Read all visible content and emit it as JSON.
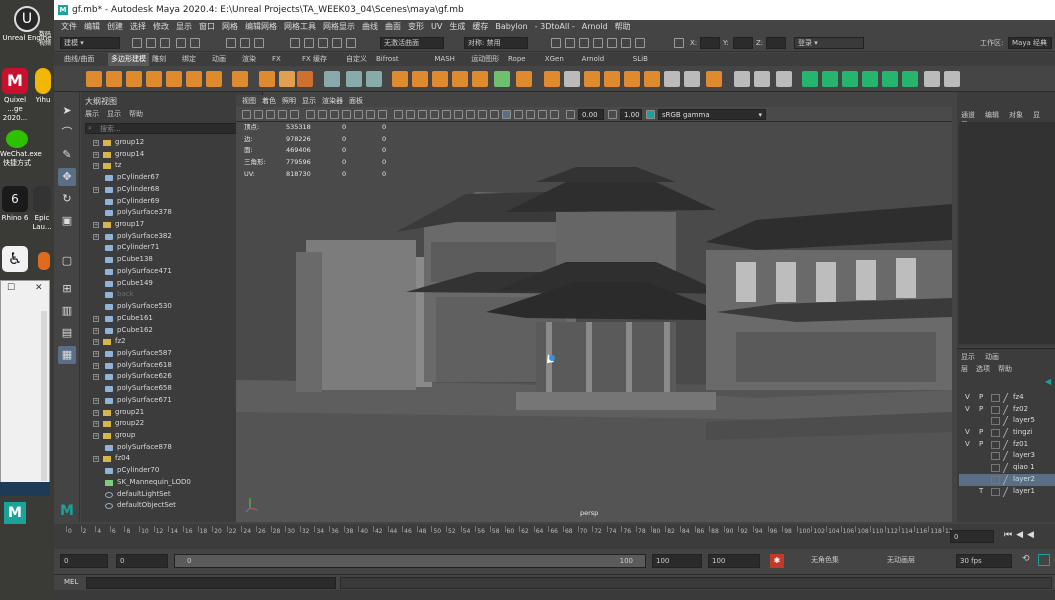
{
  "desktop": {
    "icons": [
      {
        "name": "unreal-engine-icon",
        "label": "Unreal Engine",
        "color": "#2b2b2b"
      },
      {
        "name": "quixel-bridge-icon",
        "label": "Quixel ...ge 2020...",
        "color": "#c8102e"
      },
      {
        "name": "wechat-icon",
        "label": "WeChat.exe 快捷方式",
        "color": "#2dc100"
      },
      {
        "name": "rhino-icon",
        "label": "Rhino 6",
        "color": "#1a1a1a"
      },
      {
        "name": "epic-launcher-icon",
        "label": "Epic Lau...",
        "color": "#333333"
      },
      {
        "name": "figure-app-icon",
        "label": "",
        "color": "#f2f2f2"
      }
    ],
    "extra_labels": {
      "yihu": "Yihu",
      "yihu2": "数码",
      "yihu3": "视频"
    }
  },
  "titlebar": {
    "title": "gf.mb* - Autodesk Maya 2020.4: E:\\Unreal Projects\\TA_WEEK03_04\\Scenes\\maya\\gf.mb"
  },
  "menubar": [
    "文件",
    "编辑",
    "创建",
    "选择",
    "修改",
    "显示",
    "窗口",
    "网格",
    "编辑网格",
    "网格工具",
    "网格显示",
    "曲线",
    "曲面",
    "变形",
    "UV",
    "生成",
    "缓存",
    "Babylon",
    "- 3DtoAll -",
    "Arnold",
    "帮助"
  ],
  "statusline": {
    "mode": "建模",
    "live_surface": "无激活曲面",
    "symmetry": "对称: 禁用",
    "x_label": "X:",
    "y_label": "Y:",
    "z_label": "Z:",
    "login": "登录",
    "workspace_label": "工作区:",
    "workspace_value": "Maya 经典"
  },
  "shelf_tabs": [
    "曲线/曲面",
    "多边形建模",
    "雕刻",
    "绑定",
    "动画",
    "渲染",
    "FX",
    "FX 缓存",
    "自定义",
    "Bifrost",
    "MASH",
    "运动图形",
    "Rope",
    "XGen",
    "Arnold",
    "SLiB"
  ],
  "shelf_active_tab": "多边形建模",
  "outliner": {
    "title": "大纲视图",
    "menu": [
      "展示",
      "显示",
      "帮助"
    ],
    "search_placeholder": "搜索...",
    "items": [
      {
        "label": "group12",
        "type": "group",
        "depth": 1,
        "expandable": true
      },
      {
        "label": "group14",
        "type": "group",
        "depth": 1,
        "expandable": true
      },
      {
        "label": "tz",
        "type": "group",
        "depth": 1,
        "expandable": true
      },
      {
        "label": "pCylinder67",
        "type": "mesh",
        "depth": 1
      },
      {
        "label": "pCylinder68",
        "type": "mesh",
        "depth": 1,
        "expandable": true
      },
      {
        "label": "pCylinder69",
        "type": "mesh",
        "depth": 1
      },
      {
        "label": "polySurface378",
        "type": "mesh",
        "depth": 1
      },
      {
        "label": "group17",
        "type": "group",
        "depth": 1,
        "expandable": true
      },
      {
        "label": "polySurface382",
        "type": "mesh",
        "depth": 1,
        "expandable": true
      },
      {
        "label": "pCylinder71",
        "type": "mesh",
        "depth": 1
      },
      {
        "label": "pCube138",
        "type": "mesh",
        "depth": 1
      },
      {
        "label": "polySurface471",
        "type": "mesh",
        "depth": 1
      },
      {
        "label": "pCube149",
        "type": "mesh",
        "depth": 1
      },
      {
        "label": "back",
        "type": "mesh",
        "depth": 1,
        "dim": true
      },
      {
        "label": "polySurface530",
        "type": "mesh",
        "depth": 1
      },
      {
        "label": "pCube161",
        "type": "mesh",
        "depth": 1,
        "expandable": true
      },
      {
        "label": "pCube162",
        "type": "mesh",
        "depth": 1,
        "expandable": true
      },
      {
        "label": "fz2",
        "type": "group",
        "depth": 1,
        "expandable": true
      },
      {
        "label": "polySurface587",
        "type": "mesh",
        "depth": 1,
        "expandable": true
      },
      {
        "label": "polySurface618",
        "type": "mesh",
        "depth": 1,
        "expandable": true
      },
      {
        "label": "polySurface626",
        "type": "mesh",
        "depth": 1,
        "expandable": true
      },
      {
        "label": "polySurface658",
        "type": "mesh",
        "depth": 1
      },
      {
        "label": "polySurface671",
        "type": "mesh",
        "depth": 1,
        "expandable": true
      },
      {
        "label": "group21",
        "type": "group",
        "depth": 1,
        "expandable": true
      },
      {
        "label": "group22",
        "type": "group",
        "depth": 1,
        "expandable": true
      },
      {
        "label": "group",
        "type": "group",
        "depth": 1,
        "expandable": true
      },
      {
        "label": "polySurface878",
        "type": "mesh",
        "depth": 1
      },
      {
        "label": "fz04",
        "type": "group",
        "depth": 1,
        "expandable": true
      },
      {
        "label": "pCylinder70",
        "type": "mesh",
        "depth": 1
      },
      {
        "label": "SK_Mannequin_LOD0",
        "type": "skel",
        "depth": 1
      },
      {
        "label": "defaultLightSet",
        "type": "set",
        "depth": 1
      },
      {
        "label": "defaultObjectSet",
        "type": "set",
        "depth": 1
      }
    ]
  },
  "viewport": {
    "menu": [
      "视图",
      "着色",
      "照明",
      "显示",
      "渲染器",
      "面板"
    ],
    "exposure": "0.00",
    "gamma": "1.00",
    "color_space": "sRGB gamma",
    "camera": "persp",
    "hud": [
      {
        "label": "顶点:",
        "a": "535318",
        "b": "0",
        "c": "0"
      },
      {
        "label": "边:",
        "a": "978226",
        "b": "0",
        "c": "0"
      },
      {
        "label": "面:",
        "a": "469406",
        "b": "0",
        "c": "0"
      },
      {
        "label": "三角形:",
        "a": "779596",
        "b": "0",
        "c": "0"
      },
      {
        "label": "UV:",
        "a": "818730",
        "b": "0",
        "c": "0"
      }
    ]
  },
  "channel_box": {
    "menu": [
      "通道",
      "编辑",
      "对象",
      "显示"
    ]
  },
  "layers": {
    "tabs": [
      "显示",
      "动画"
    ],
    "menu": [
      "层",
      "选项",
      "帮助"
    ],
    "items": [
      {
        "name": "fz4",
        "v": "V",
        "p": "P",
        "selected": false
      },
      {
        "name": "fz02",
        "v": "V",
        "p": "P",
        "selected": false
      },
      {
        "name": "layer5",
        "v": "",
        "p": "",
        "selected": false
      },
      {
        "name": "tingzi",
        "v": "V",
        "p": "P",
        "selected": false
      },
      {
        "name": "fz01",
        "v": "V",
        "p": "P",
        "selected": false
      },
      {
        "name": "layer3",
        "v": "",
        "p": "",
        "selected": false
      },
      {
        "name": "qiao 1",
        "v": "",
        "p": "",
        "selected": false
      },
      {
        "name": "layer2",
        "v": "",
        "p": "",
        "selected": true
      },
      {
        "name": "layer1",
        "v": "",
        "p": "T",
        "selected": false
      }
    ]
  },
  "timeslider": {
    "ticks": [
      "0",
      "2",
      "4",
      "6",
      "8",
      "10",
      "12",
      "14",
      "16",
      "18",
      "20",
      "22",
      "24",
      "26",
      "28",
      "30",
      "32",
      "34",
      "36",
      "38",
      "40",
      "42",
      "44",
      "46",
      "48",
      "50",
      "52",
      "54",
      "56",
      "58",
      "60",
      "62",
      "64",
      "66",
      "68",
      "70",
      "72",
      "74",
      "76",
      "78",
      "80",
      "82",
      "84",
      "86",
      "88",
      "90",
      "92",
      "94",
      "96",
      "98",
      "100",
      "102",
      "104",
      "106",
      "108",
      "110",
      "112",
      "114",
      "116",
      "118",
      "12"
    ],
    "current_frame": "0"
  },
  "rangebar": {
    "start": "0",
    "anim_start": "0",
    "range_start": "0",
    "range_end": "100",
    "end": "100",
    "anim_end": "100",
    "character_set": "无角色集",
    "anim_layer": "无动画层",
    "fps": "30 fps"
  },
  "cmdline": {
    "label": "MEL"
  },
  "colors": {
    "accent": "#5a6f85",
    "maya_teal": "#1aa39a",
    "shelf_orange": "#e08a2e",
    "shelf_green": "#26b56f"
  }
}
